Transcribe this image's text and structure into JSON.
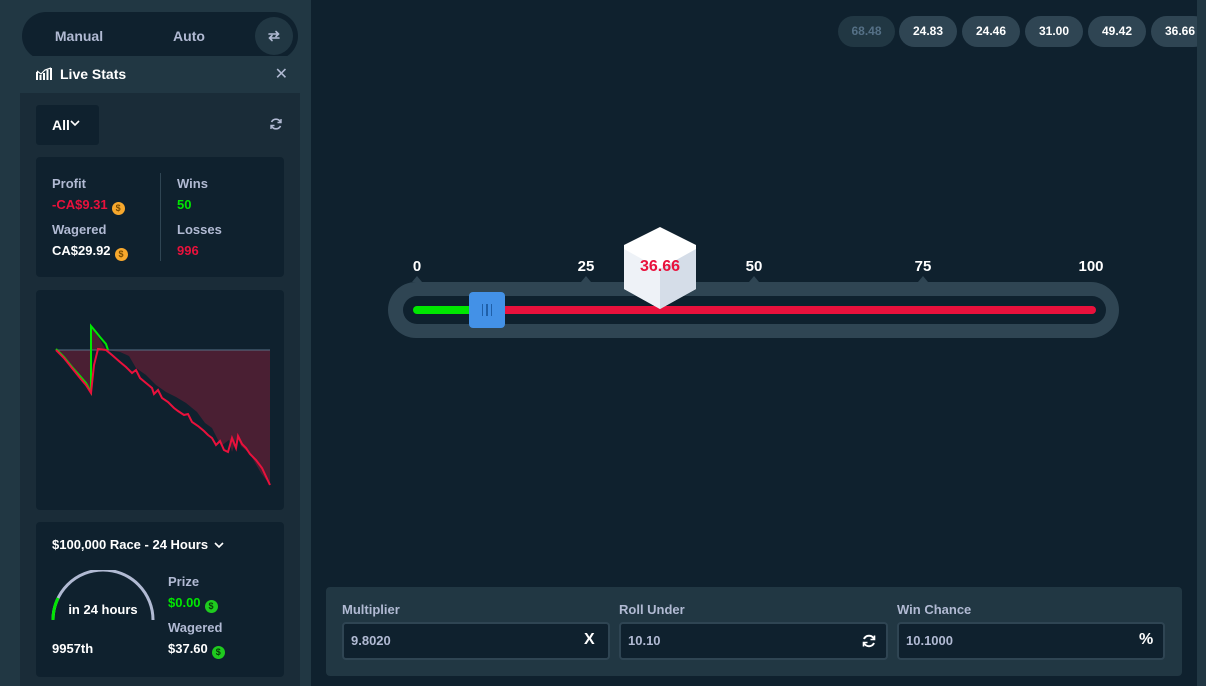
{
  "mode_toggle": {
    "manual_label": "Manual",
    "auto_label": "Auto"
  },
  "live_stats": {
    "title": "Live Stats",
    "filter_value": "All",
    "profit_label": "Profit",
    "profit_value": "-CA$9.31",
    "wagered_label": "Wagered",
    "wagered_value": "CA$29.92",
    "wins_label": "Wins",
    "wins_value": "50",
    "losses_label": "Losses",
    "losses_value": "996",
    "colors": {
      "negative": "#e9113c",
      "positive": "#00e701"
    }
  },
  "race": {
    "title": "$100,000 Race - 24 Hours",
    "time_left": "in 24 hours",
    "rank": "9957th",
    "prize_label": "Prize",
    "prize_value": "$0.00",
    "wagered_label": "Wagered",
    "wagered_value": "$37.60"
  },
  "history": [
    "68.48",
    "24.83",
    "24.46",
    "31.00",
    "49.42",
    "36.66"
  ],
  "slider": {
    "ticks": [
      "0",
      "25",
      "50",
      "75",
      "100"
    ],
    "roll_under": 10.1,
    "result": "36.66"
  },
  "controls": {
    "multiplier_label": "Multiplier",
    "multiplier_value": "9.8020",
    "multiplier_suffix": "X",
    "roll_under_label": "Roll Under",
    "roll_under_value": "10.10",
    "win_chance_label": "Win Chance",
    "win_chance_value": "10.1000",
    "win_chance_suffix": "%"
  }
}
